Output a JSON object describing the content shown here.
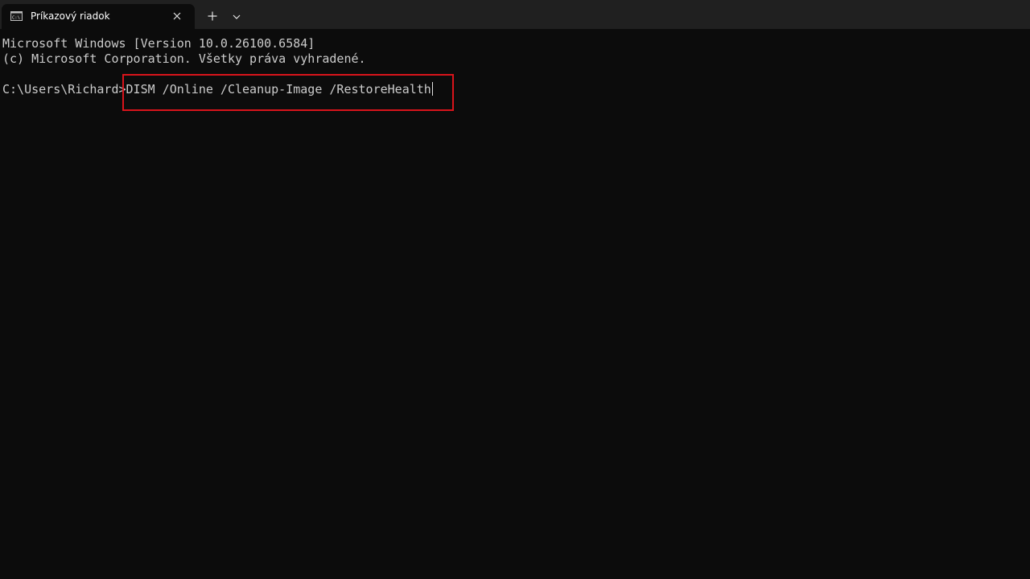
{
  "tab": {
    "title": "Príkazový riadok",
    "icon": "cmd-icon"
  },
  "tabbar_icons": {
    "close": "close-icon",
    "new_tab": "plus-icon",
    "dropdown": "chevron-down-icon"
  },
  "terminal": {
    "lines": [
      "Microsoft Windows [Version 10.0.26100.6584]",
      "(c) Microsoft Corporation. Všetky práva vyhradené."
    ],
    "prompt": "C:\\Users\\Richard>",
    "command": "DISM /Online /Cleanup-Image /RestoreHealth"
  },
  "colors": {
    "background": "#0c0c0c",
    "tabbar": "#202020",
    "text": "#cccccc",
    "highlight": "#d9141b"
  }
}
